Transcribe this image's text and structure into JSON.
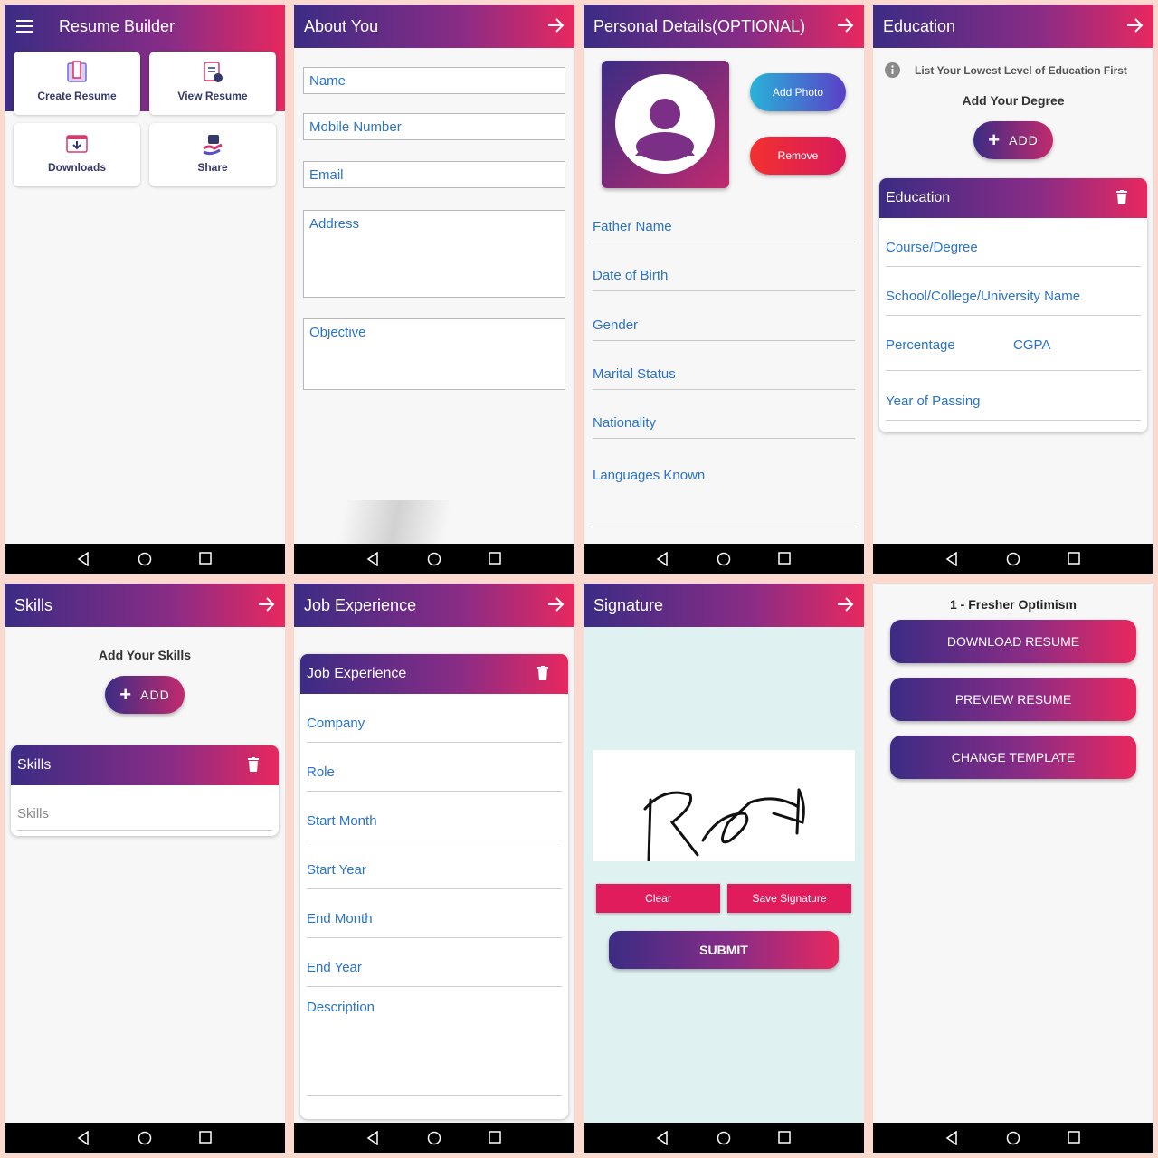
{
  "screens": {
    "home": {
      "title": "Resume Builder",
      "tiles": [
        "Create Resume",
        "View Resume",
        "Downloads",
        "Share"
      ]
    },
    "about": {
      "title": "About You",
      "fields": [
        "Name",
        "Mobile Number",
        "Email",
        "Address",
        "Objective"
      ]
    },
    "personal": {
      "title": "Personal Details(OPTIONAL)",
      "add_photo": "Add Photo",
      "remove": "Remove",
      "fields": [
        "Father Name",
        "Date of Birth",
        "Gender",
        "Marital Status",
        "Nationality",
        "Languages Known"
      ]
    },
    "education": {
      "title": "Education",
      "info": "List Your Lowest Level of Education First",
      "add_heading": "Add Your Degree",
      "add_label": "ADD",
      "card_title": "Education",
      "fields": [
        "Course/Degree",
        "School/College/University Name",
        "Percentage",
        "CGPA",
        "Year of Passing"
      ]
    },
    "skills": {
      "title": "Skills",
      "add_heading": "Add Your Skills",
      "add_label": "ADD",
      "card_title": "Skills",
      "field": "Skills"
    },
    "job": {
      "title": "Job Experience",
      "card_title": "Job Experience",
      "fields": [
        "Company",
        "Role",
        "Start Month",
        "Start Year",
        "End Month",
        "End Year",
        "Description"
      ]
    },
    "signature": {
      "title": "Signature",
      "clear": "Clear",
      "save": "Save Signature",
      "submit": "SUBMIT"
    },
    "final": {
      "template": "1 - Fresher Optimism",
      "download": "DOWNLOAD RESUME",
      "preview": "PREVIEW RESUME",
      "change": "CHANGE TEMPLATE"
    }
  },
  "colors": {
    "gradient_start": "#3b2c84",
    "gradient_end": "#e8285f",
    "field_text": "#2b73c6",
    "signature_bg": "#e0f1f1",
    "clear_button": "#e01c5c"
  },
  "icons": [
    "menu-icon",
    "arrow-right-icon",
    "trash-icon",
    "info-icon",
    "avatar-icon",
    "nav-back-icon",
    "nav-home-icon",
    "nav-recent-icon"
  ]
}
